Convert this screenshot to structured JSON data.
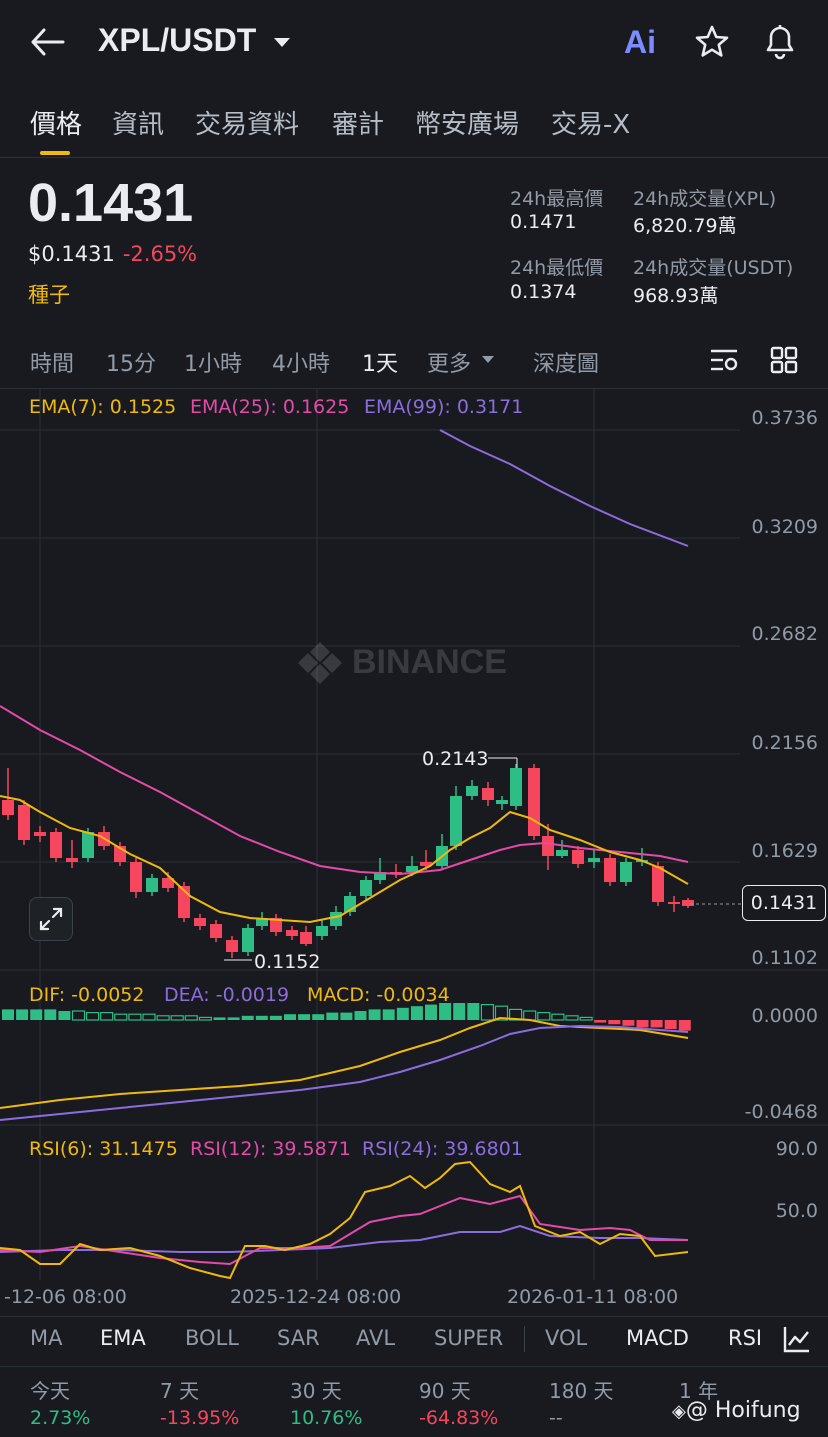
{
  "header": {
    "pair": "XPL/USDT",
    "ai_label": "Ai"
  },
  "tabs": [
    "價格",
    "資訊",
    "交易資料",
    "審計",
    "幣安廣場",
    "交易-X"
  ],
  "ticker": {
    "price": "0.1431",
    "usd_price": "$0.1431",
    "change_pct": "-2.65%",
    "tag": "種子",
    "stats": {
      "high_label": "24h最高價",
      "high": "0.1471",
      "vol_xpl_label": "24h成交量(XPL)",
      "vol_xpl": "6,820.79萬",
      "low_label": "24h最低價",
      "low": "0.1374",
      "vol_usdt_label": "24h成交量(USDT)",
      "vol_usdt": "968.93萬"
    }
  },
  "timeframes": [
    "時間",
    "15分",
    "1小時",
    "4小時",
    "1天",
    "更多",
    "深度圖"
  ],
  "selected_timeframe": "1天",
  "main_chart": {
    "ema_legend": {
      "ema7": "EMA(7): 0.1525",
      "ema25": "EMA(25): 0.1625",
      "ema99": "EMA(99): 0.3171"
    },
    "y_ticks": [
      "0.3736",
      "0.3209",
      "0.2682",
      "0.2156",
      "0.1629",
      "0.1102"
    ],
    "current_price_tag": "0.1431",
    "high_marker": "0.2143",
    "low_marker": "0.1152",
    "watermark": "BINANCE"
  },
  "macd": {
    "legend": {
      "dif": "DIF: -0.0052",
      "dea": "DEA: -0.0019",
      "macd": "MACD: -0.0034"
    },
    "y_ticks": [
      "0.0000",
      "-0.0468"
    ]
  },
  "rsi": {
    "legend": {
      "rsi6": "RSI(6): 31.1475",
      "rsi12": "RSI(12): 39.5871",
      "rsi24": "RSI(24): 39.6801"
    },
    "y_ticks": [
      "90.0",
      "50.0"
    ]
  },
  "x_axis": [
    "-12-06 08:00",
    "2025-12-24 08:00",
    "2026-01-11 08:00"
  ],
  "indicators": [
    "MA",
    "EMA",
    "BOLL",
    "SAR",
    "AVL",
    "SUPER",
    "VOL",
    "MACD",
    "RSI"
  ],
  "performance": [
    {
      "label": "今天",
      "value": "2.73%"
    },
    {
      "label": "7 天",
      "value": "-13.95%"
    },
    {
      "label": "30 天",
      "value": "10.76%"
    },
    {
      "label": "90 天",
      "value": "-64.83%"
    },
    {
      "label": "180 天",
      "value": "--"
    },
    {
      "label": "1 年",
      "value": ""
    }
  ],
  "watermark_user": "@ Hoifung",
  "colors": {
    "up": "#2ebd85",
    "down": "#f6465d",
    "accent": "#f0b90b",
    "ema7": "#f0b90b",
    "ema25": "#e34ba8",
    "ema99": "#8b6ddc"
  },
  "icons": [
    "back-arrow-icon",
    "dropdown-caret-icon",
    "ai-icon",
    "star-icon",
    "bell-icon",
    "chart-settings-icon",
    "grid-icon",
    "expand-icon",
    "indicator-chart-icon"
  ]
}
